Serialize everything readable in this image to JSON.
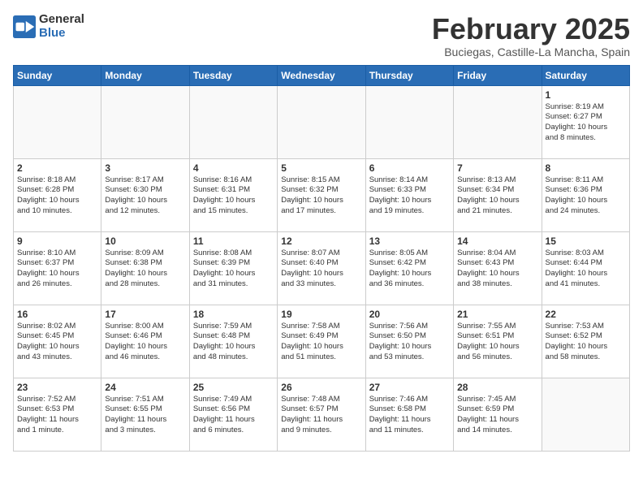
{
  "logo": {
    "line1": "General",
    "line2": "Blue"
  },
  "title": "February 2025",
  "subtitle": "Buciegas, Castille-La Mancha, Spain",
  "days_of_week": [
    "Sunday",
    "Monday",
    "Tuesday",
    "Wednesday",
    "Thursday",
    "Friday",
    "Saturday"
  ],
  "weeks": [
    [
      {
        "day": "",
        "info": ""
      },
      {
        "day": "",
        "info": ""
      },
      {
        "day": "",
        "info": ""
      },
      {
        "day": "",
        "info": ""
      },
      {
        "day": "",
        "info": ""
      },
      {
        "day": "",
        "info": ""
      },
      {
        "day": "1",
        "info": "Sunrise: 8:19 AM\nSunset: 6:27 PM\nDaylight: 10 hours\nand 8 minutes."
      }
    ],
    [
      {
        "day": "2",
        "info": "Sunrise: 8:18 AM\nSunset: 6:28 PM\nDaylight: 10 hours\nand 10 minutes."
      },
      {
        "day": "3",
        "info": "Sunrise: 8:17 AM\nSunset: 6:30 PM\nDaylight: 10 hours\nand 12 minutes."
      },
      {
        "day": "4",
        "info": "Sunrise: 8:16 AM\nSunset: 6:31 PM\nDaylight: 10 hours\nand 15 minutes."
      },
      {
        "day": "5",
        "info": "Sunrise: 8:15 AM\nSunset: 6:32 PM\nDaylight: 10 hours\nand 17 minutes."
      },
      {
        "day": "6",
        "info": "Sunrise: 8:14 AM\nSunset: 6:33 PM\nDaylight: 10 hours\nand 19 minutes."
      },
      {
        "day": "7",
        "info": "Sunrise: 8:13 AM\nSunset: 6:34 PM\nDaylight: 10 hours\nand 21 minutes."
      },
      {
        "day": "8",
        "info": "Sunrise: 8:11 AM\nSunset: 6:36 PM\nDaylight: 10 hours\nand 24 minutes."
      }
    ],
    [
      {
        "day": "9",
        "info": "Sunrise: 8:10 AM\nSunset: 6:37 PM\nDaylight: 10 hours\nand 26 minutes."
      },
      {
        "day": "10",
        "info": "Sunrise: 8:09 AM\nSunset: 6:38 PM\nDaylight: 10 hours\nand 28 minutes."
      },
      {
        "day": "11",
        "info": "Sunrise: 8:08 AM\nSunset: 6:39 PM\nDaylight: 10 hours\nand 31 minutes."
      },
      {
        "day": "12",
        "info": "Sunrise: 8:07 AM\nSunset: 6:40 PM\nDaylight: 10 hours\nand 33 minutes."
      },
      {
        "day": "13",
        "info": "Sunrise: 8:05 AM\nSunset: 6:42 PM\nDaylight: 10 hours\nand 36 minutes."
      },
      {
        "day": "14",
        "info": "Sunrise: 8:04 AM\nSunset: 6:43 PM\nDaylight: 10 hours\nand 38 minutes."
      },
      {
        "day": "15",
        "info": "Sunrise: 8:03 AM\nSunset: 6:44 PM\nDaylight: 10 hours\nand 41 minutes."
      }
    ],
    [
      {
        "day": "16",
        "info": "Sunrise: 8:02 AM\nSunset: 6:45 PM\nDaylight: 10 hours\nand 43 minutes."
      },
      {
        "day": "17",
        "info": "Sunrise: 8:00 AM\nSunset: 6:46 PM\nDaylight: 10 hours\nand 46 minutes."
      },
      {
        "day": "18",
        "info": "Sunrise: 7:59 AM\nSunset: 6:48 PM\nDaylight: 10 hours\nand 48 minutes."
      },
      {
        "day": "19",
        "info": "Sunrise: 7:58 AM\nSunset: 6:49 PM\nDaylight: 10 hours\nand 51 minutes."
      },
      {
        "day": "20",
        "info": "Sunrise: 7:56 AM\nSunset: 6:50 PM\nDaylight: 10 hours\nand 53 minutes."
      },
      {
        "day": "21",
        "info": "Sunrise: 7:55 AM\nSunset: 6:51 PM\nDaylight: 10 hours\nand 56 minutes."
      },
      {
        "day": "22",
        "info": "Sunrise: 7:53 AM\nSunset: 6:52 PM\nDaylight: 10 hours\nand 58 minutes."
      }
    ],
    [
      {
        "day": "23",
        "info": "Sunrise: 7:52 AM\nSunset: 6:53 PM\nDaylight: 11 hours\nand 1 minute."
      },
      {
        "day": "24",
        "info": "Sunrise: 7:51 AM\nSunset: 6:55 PM\nDaylight: 11 hours\nand 3 minutes."
      },
      {
        "day": "25",
        "info": "Sunrise: 7:49 AM\nSunset: 6:56 PM\nDaylight: 11 hours\nand 6 minutes."
      },
      {
        "day": "26",
        "info": "Sunrise: 7:48 AM\nSunset: 6:57 PM\nDaylight: 11 hours\nand 9 minutes."
      },
      {
        "day": "27",
        "info": "Sunrise: 7:46 AM\nSunset: 6:58 PM\nDaylight: 11 hours\nand 11 minutes."
      },
      {
        "day": "28",
        "info": "Sunrise: 7:45 AM\nSunset: 6:59 PM\nDaylight: 11 hours\nand 14 minutes."
      },
      {
        "day": "",
        "info": ""
      }
    ]
  ]
}
